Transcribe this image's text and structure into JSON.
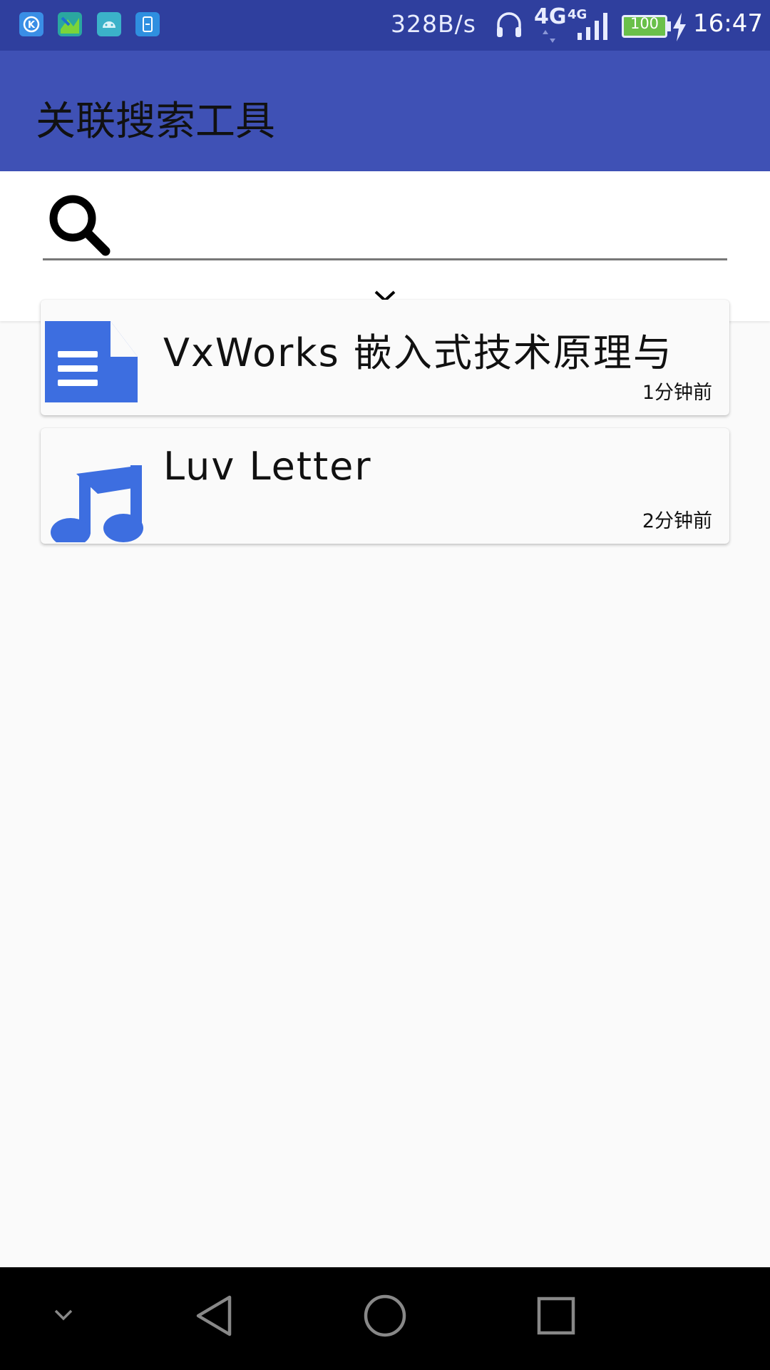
{
  "status_bar": {
    "network_speed": "328B/s",
    "network_type_1": "4G",
    "network_type_2": "4G",
    "battery": "100",
    "time": "16:47",
    "app_icons": [
      "k-app-icon",
      "map-app-icon",
      "android-app-icon",
      "tablet-app-icon"
    ]
  },
  "app_bar": {
    "title": "关联搜索工具"
  },
  "search": {
    "value": "",
    "placeholder": ""
  },
  "results": [
    {
      "icon": "document-icon",
      "title": "VxWorks 嵌入式技术原理与",
      "time": "1分钟前"
    },
    {
      "icon": "music-note-icon",
      "title": "Luv Letter",
      "time": "2分钟前"
    }
  ],
  "nav_bar": {
    "buttons": [
      "collapse-icon",
      "back-icon",
      "home-icon",
      "recents-icon"
    ]
  },
  "colors": {
    "status_bar": "#2f3f9e",
    "app_bar": "#3f51b5",
    "icon_blue": "#3d6ee0",
    "background": "#fafafa"
  }
}
